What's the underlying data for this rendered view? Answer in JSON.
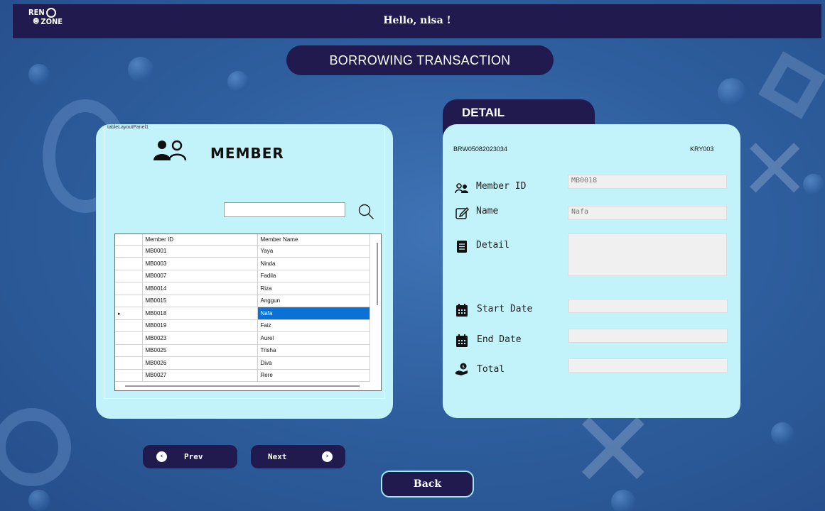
{
  "header": {
    "logo_line1": "REN",
    "logo_line2": "ZONE",
    "greeting": "Hello, nisa !"
  },
  "page_title": "BORROWING TRANSACTION",
  "member_panel": {
    "title": "MEMBER",
    "caption_text": "tableLayoutPanel1",
    "search": {
      "value": "",
      "placeholder": ""
    },
    "grid": {
      "columns": [
        "Member ID",
        "Member Name"
      ],
      "rows": [
        {
          "id": "MB0001",
          "name": "Yaya",
          "selected": false
        },
        {
          "id": "MB0003",
          "name": "Ninda",
          "selected": false
        },
        {
          "id": "MB0007",
          "name": "Fadila",
          "selected": false
        },
        {
          "id": "MB0014",
          "name": "Riza",
          "selected": false
        },
        {
          "id": "MB0015",
          "name": "Anggun",
          "selected": false
        },
        {
          "id": "MB0018",
          "name": "Nafa",
          "selected": true
        },
        {
          "id": "MB0019",
          "name": "Faiz",
          "selected": false
        },
        {
          "id": "MB0023",
          "name": "Aurel",
          "selected": false
        },
        {
          "id": "MB0025",
          "name": "Trisha",
          "selected": false
        },
        {
          "id": "MB0026",
          "name": "Diva",
          "selected": false
        },
        {
          "id": "MB0027",
          "name": "Rere",
          "selected": false
        }
      ],
      "row_indicator": "▸"
    }
  },
  "detail_panel": {
    "tab_label": "DETAIL",
    "transaction_code": "BRW05082023034",
    "employee_code": "KRY003",
    "fields": {
      "member_id": {
        "label": "Member ID",
        "value": "MB0018"
      },
      "name": {
        "label": "Name",
        "value": "Nafa"
      },
      "detail": {
        "label": "Detail",
        "value": ""
      },
      "start_date": {
        "label": "Start Date",
        "value": ""
      },
      "end_date": {
        "label": "End Date",
        "value": ""
      },
      "total": {
        "label": "Total",
        "value": ""
      }
    }
  },
  "nav": {
    "prev_label": "Prev",
    "next_label": "Next",
    "back_label": "Back"
  },
  "colors": {
    "navy": "#211a4f",
    "panel": "#c2f3fb",
    "selection": "#0a72d6",
    "background": "#2f5f9f"
  }
}
